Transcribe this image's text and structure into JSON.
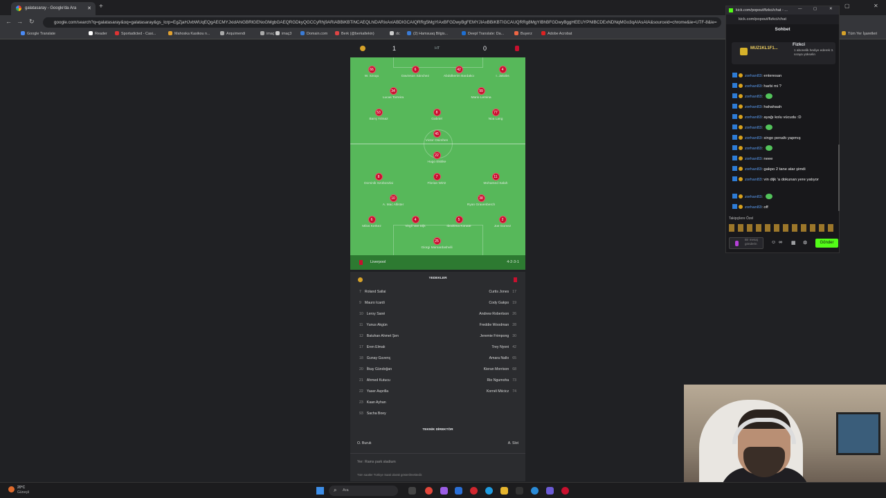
{
  "browser": {
    "tab_title": "galatasaray - Google'da Ara",
    "address": "google.com/search?q=galatasaray&oq=galatasaray&gs_lcrp=EgZjaHJvbWUqEQgAECMYJxidAhiGBRlGENoGMgbGAEQRGDkyQGCCyRhj9ARiABBiKBTiNCAEQLhiDARixAxiABDIGCAIQRRg5MgYIAxBFGDwyBgFEMYJIAxBBiKBTIGCAUQRRg8MgYIBhBFGDwyBggHEEUYPNIBCDExNDNqMGo3qAIAsAIA&sourceid=chrome&ie=UTF-8&ie=",
    "bookmarks": [
      "Google Translate",
      "Reader",
      "Sportadicted - Casi...",
      "Mahoska Kasikou n...",
      "Arquimendi",
      "imaç",
      "imaç3",
      "Domain.com",
      "Berk (@berkaltekin)",
      "dc",
      "(2) Hamsuaq Bilgis...",
      "Deepl Translate: Da...",
      "Buyerz",
      "Adobe Acrobat",
      "Tüm Yer İşaretleri"
    ]
  },
  "match": {
    "home_score": "1",
    "away_score": "0",
    "minute": "HT"
  },
  "lineup": {
    "players": [
      {
        "no": "66",
        "name": "W. Szoqu"
      },
      {
        "no": "6",
        "name": "Davinson Sánchez"
      },
      {
        "no": "42",
        "name": "Abdülkerim Bardakcı"
      },
      {
        "no": "4",
        "name": "I. Jakobs"
      },
      {
        "no": "34",
        "name": "Lucas Torreira"
      },
      {
        "no": "99",
        "name": "Mario Lemina"
      },
      {
        "no": "53",
        "name": "Barış Yılmaz"
      },
      {
        "no": "8",
        "name": "Gabriel"
      },
      {
        "no": "77",
        "name": "Noa Lang"
      },
      {
        "no": "45",
        "name": "Victor Osimhen"
      },
      {
        "no": "22",
        "name": "Hugo Ekitike"
      },
      {
        "no": "8",
        "name": "Dominik Szoboszlai"
      },
      {
        "no": "7",
        "name": "Florian Wirtz"
      },
      {
        "no": "11",
        "name": "Mohamed Salah"
      },
      {
        "no": "10",
        "name": "A. Mac Allister"
      },
      {
        "no": "38",
        "name": "Ryan Gravenberch"
      },
      {
        "no": "6",
        "name": "Milos Kerkez"
      },
      {
        "no": "4",
        "name": "Virgil Van Dijk"
      },
      {
        "no": "5",
        "name": "Ibrahima Konate"
      },
      {
        "no": "2",
        "name": "Joe Gomez"
      },
      {
        "no": "25",
        "name": "Giorgi Mamardashvili"
      }
    ],
    "team_name": "Liverpool",
    "formation": "4-2-3-1"
  },
  "subs": {
    "title": "YEDEKLER",
    "home": [
      {
        "no": "7",
        "name": "Roland Sallai"
      },
      {
        "no": "9",
        "name": "Mauro Icardi"
      },
      {
        "no": "10",
        "name": "Leroy Sané"
      },
      {
        "no": "11",
        "name": "Yunus Akgün"
      },
      {
        "no": "12",
        "name": "Batuhan Ahmet Şen"
      },
      {
        "no": "17",
        "name": "Eren Elmalı"
      },
      {
        "no": "18",
        "name": "Gunay Guvenç"
      },
      {
        "no": "20",
        "name": "İlkay Gündoğan"
      },
      {
        "no": "21",
        "name": "Ahmed Kutucu"
      },
      {
        "no": "22",
        "name": "Yaser Asprilla"
      },
      {
        "no": "23",
        "name": "Kaan Ayhan"
      },
      {
        "no": "93",
        "name": "Sacha Boey"
      }
    ],
    "away": [
      {
        "no": "17",
        "name": "Curtis Jones"
      },
      {
        "no": "19",
        "name": "Cody Gakpo"
      },
      {
        "no": "26",
        "name": "Andrew Robertson"
      },
      {
        "no": "28",
        "name": "Freddie Woodman"
      },
      {
        "no": "30",
        "name": "Jeremie Frimpong"
      },
      {
        "no": "42",
        "name": "Trey Nyoni"
      },
      {
        "no": "65",
        "name": "Amara Nallo"
      },
      {
        "no": "68",
        "name": "Kieran Morrison"
      },
      {
        "no": "73",
        "name": "Rio Ngumoha"
      },
      {
        "no": "74",
        "name": "Kornél Mścicz"
      }
    ],
    "coach_title": "TEKNİK DİREKTÖR",
    "home_coach": "O. Buruk",
    "away_coach": "A. Slot",
    "venue_label": "Yer:",
    "venue": "Rams park stadium",
    "footnote": "Tüm saatler Türkiye Saati olarak gösterilmektedir."
  },
  "chat": {
    "window_title": "kick.com/popout/fizkci/chat - ...",
    "url": "kick.com/popout/fizkci/chat",
    "header": "Sohbet",
    "gift_user": "MUZ1KL1F1...",
    "gift_streamer": "Fizkci",
    "gift_text": "1 abonelik hediye ederek 3. sıraya yükselin",
    "messages": [
      {
        "user": "zorhan83",
        "text": "enteresan",
        "emote": false
      },
      {
        "user": "zorhan83",
        "text": "harbi mi ?",
        "emote": false
      },
      {
        "user": "zorhan83",
        "text": "",
        "emote": true
      },
      {
        "user": "zorhan83",
        "text": "hahahaah",
        "emote": false
      },
      {
        "user": "zorhan83",
        "text": "ayağı kolu vücudu :D",
        "emote": false
      },
      {
        "user": "zorhan83",
        "text": "",
        "emote": true
      },
      {
        "user": "zorhan83",
        "text": "singo penaltı yapmış",
        "emote": false
      },
      {
        "user": "zorhan83",
        "text": "",
        "emote": true
      },
      {
        "user": "zorhan83",
        "text": "neee",
        "emote": false
      },
      {
        "user": "zorhan83",
        "text": "gakpo 2 tane atar şimdi",
        "emote": false
      },
      {
        "user": "zorhan83",
        "text": "vin dijk 'a dokunan yere yatıyor",
        "emote": false
      },
      {
        "user": "zorhan83",
        "text": "",
        "emote": true
      },
      {
        "user": "zorhan83",
        "text": "off",
        "emote": false
      }
    ],
    "followers_label": "Takipçilere Özel",
    "input_placeholder": "Bir mesaj gönderin",
    "send_label": "Gönder"
  },
  "taskbar": {
    "weather_temp": "20°C",
    "weather_desc": "Güneşli",
    "search_label": "Ara"
  },
  "colors": {
    "pitch": "#57b85a",
    "player_dot": "#c8102e",
    "kick_green": "#53fc18",
    "chat_user": "#5a9bf0"
  }
}
